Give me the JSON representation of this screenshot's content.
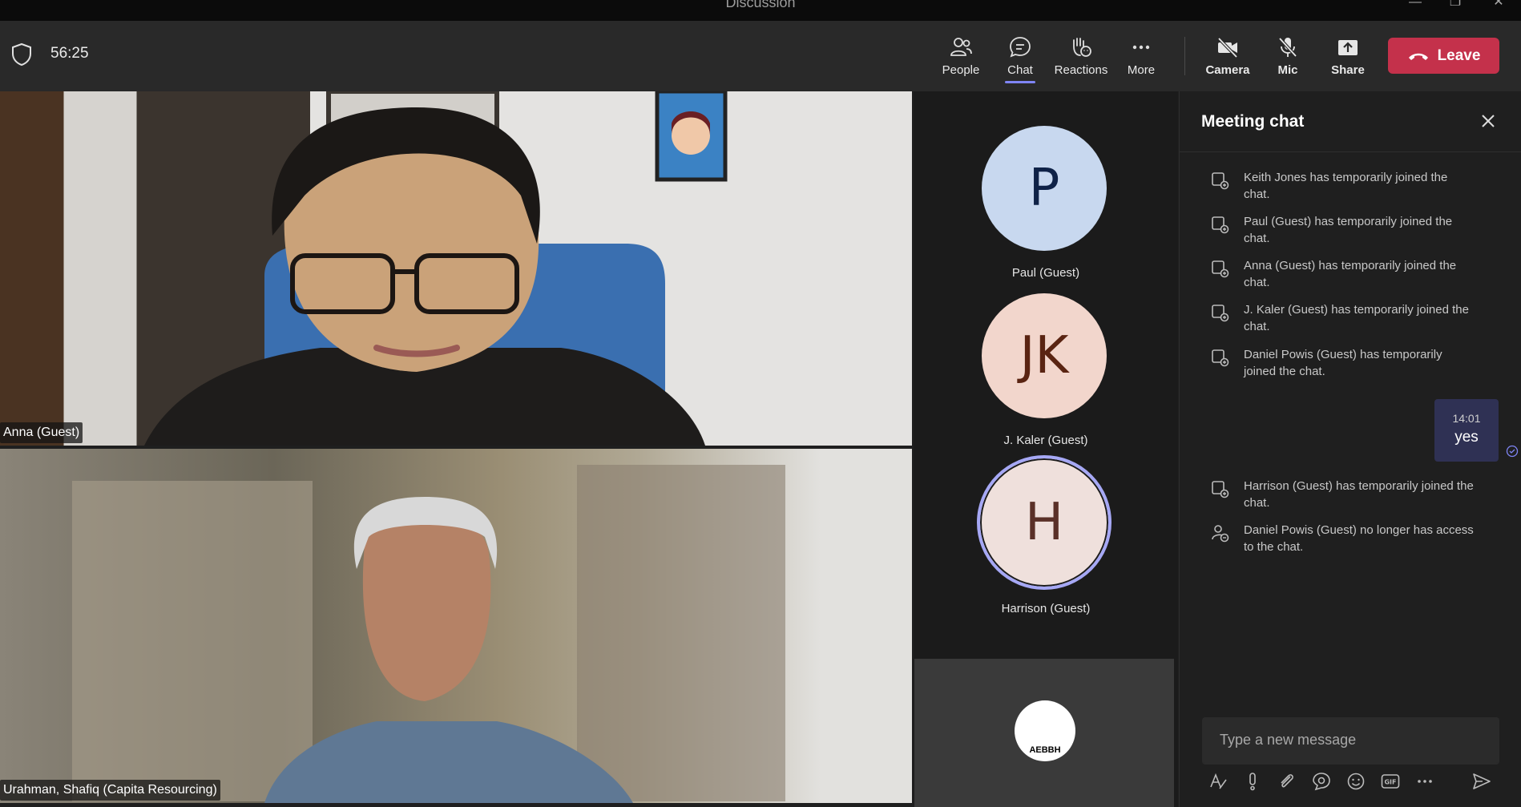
{
  "window": {
    "title": "Discussion"
  },
  "toolbar": {
    "timer": "56:25",
    "items": [
      {
        "label": "People",
        "icon": "people-icon"
      },
      {
        "label": "Chat",
        "icon": "chat-icon",
        "active": true
      },
      {
        "label": "Reactions",
        "icon": "reactions-icon"
      },
      {
        "label": "More",
        "icon": "more-icon"
      },
      {
        "label": "Camera",
        "icon": "camera-off-icon"
      },
      {
        "label": "Mic",
        "icon": "mic-off-icon"
      },
      {
        "label": "Share",
        "icon": "share-icon"
      }
    ],
    "leave_label": "Leave",
    "leave_color": "#c4314b",
    "accent_color": "#7f85f5"
  },
  "videos": [
    {
      "name": "Anna (Guest)"
    },
    {
      "name": "Urahman, Shafiq (Capita Resourcing)"
    }
  ],
  "participants": [
    {
      "initials": "P",
      "name": "Paul (Guest)",
      "bg": "#c8d8ef",
      "fg": "#0f2247"
    },
    {
      "initials": "JK",
      "name": "J. Kaler (Guest)",
      "bg": "#f2d6cc",
      "fg": "#5a2412"
    },
    {
      "initials": "H",
      "name": "Harrison (Guest)",
      "bg": "#efe0dc",
      "fg": "#5a3028",
      "speaking": true
    }
  ],
  "self_tile": {
    "logo_text": "AEBBH"
  },
  "chat": {
    "title": "Meeting chat",
    "system_messages_before": [
      "Keith Jones has temporarily joined the chat.",
      "Paul (Guest) has temporarily joined the chat.",
      "Anna (Guest) has temporarily joined the chat.",
      "J. Kaler (Guest) has temporarily joined the chat.",
      "Daniel Powis (Guest) has temporarily joined the chat."
    ],
    "my_message": {
      "time": "14:01",
      "text": "yes"
    },
    "system_messages_after": [
      {
        "text": "Harrison (Guest) has temporarily joined the chat.",
        "icon": "chat-join-icon"
      },
      {
        "text": "Daniel Powis (Guest) no longer has access to the chat.",
        "icon": "person-remove-icon"
      }
    ],
    "composer_placeholder": "Type a new message",
    "composer_tools": [
      "format-icon",
      "important-icon",
      "attach-icon",
      "loop-icon",
      "emoji-icon",
      "gif-icon",
      "more-options-icon"
    ]
  }
}
